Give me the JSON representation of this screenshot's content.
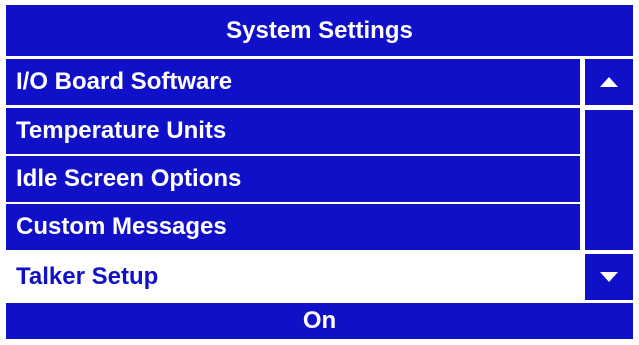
{
  "title": "System Settings",
  "menu": {
    "items": [
      {
        "label": "I/O Board Software"
      },
      {
        "label": "Temperature Units"
      },
      {
        "label": "Idle Screen Options"
      },
      {
        "label": "Custom Messages"
      },
      {
        "label": "Talker Setup"
      }
    ],
    "selected_index": 4
  },
  "scroll": {
    "up_icon": "triangle-up-icon",
    "down_icon": "triangle-down-icon"
  },
  "value": "On",
  "colors": {
    "primary": "#1010c8",
    "text_on_primary": "#ffffff",
    "selected_background": "#ffffff"
  }
}
